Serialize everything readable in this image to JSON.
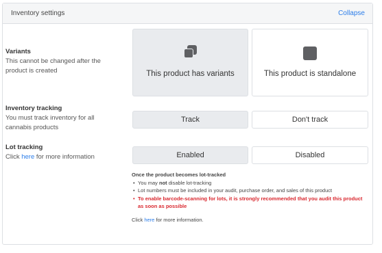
{
  "header": {
    "title": "Inventory settings",
    "collapse_label": "Collapse"
  },
  "variants": {
    "title": "Variants",
    "description": "This cannot be changed after the product is created",
    "options": [
      {
        "label": "This product has variants",
        "icon": "stacked-squares-icon",
        "selected": true
      },
      {
        "label": "This product is standalone",
        "icon": "square-icon",
        "selected": false
      }
    ]
  },
  "inventory_tracking": {
    "title": "Inventory tracking",
    "description": "You must track inventory for all cannabis products",
    "options": [
      {
        "label": "Track",
        "selected": true
      },
      {
        "label": "Don't track",
        "selected": false
      }
    ]
  },
  "lot_tracking": {
    "title": "Lot tracking",
    "description_prefix": "Click ",
    "description_link": "here",
    "description_suffix": " for more information",
    "options": [
      {
        "label": "Enabled",
        "selected": true
      },
      {
        "label": "Disabled",
        "selected": false
      }
    ]
  },
  "lot_info": {
    "heading": "Once the product becomes lot-tracked",
    "bullet1_prefix": "You may ",
    "bullet1_bold": "not",
    "bullet1_suffix": " disable lot-tracking",
    "bullet2": "Lot numbers must be included in your audit, purchase order, and sales of this product",
    "bullet3": "To enable barcode-scanning for lots, it is strongly recommended that you audit this product as soon as possible",
    "more_prefix": "Click ",
    "more_link": "here",
    "more_suffix": " for more information."
  },
  "colors": {
    "accent": "#2b7de9",
    "warning": "#d9282f",
    "selected_bg": "#e9ebee"
  }
}
